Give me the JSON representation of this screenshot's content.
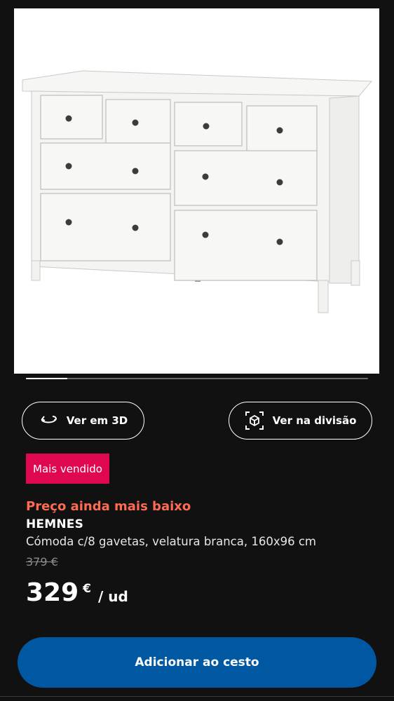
{
  "product_image": {
    "alt": "HEMNES dresser with 8 drawers, white stain"
  },
  "carousel": {
    "progress": 0.12
  },
  "actions": {
    "view_3d_label": "Ver em 3D",
    "view_3d_icon": "rotate-3d-icon",
    "view_room_label": "Ver na divisão",
    "view_room_icon": "ar-cube-icon"
  },
  "badge": {
    "label": "Mais vendido",
    "color": "#e00751"
  },
  "product": {
    "promo": "Preço ainda mais baixo",
    "name": "HEMNES",
    "description": "Cómoda c/8 gavetas, velatura branca, 160x96 cm",
    "old_price": "379 €",
    "price_integer": "329",
    "currency": "€",
    "unit": "/ ud"
  },
  "cart": {
    "add_label": "Adicionar ao cesto",
    "color": "#0058a3"
  },
  "colors": {
    "background": "#111112",
    "promo": "#ff6b52"
  }
}
